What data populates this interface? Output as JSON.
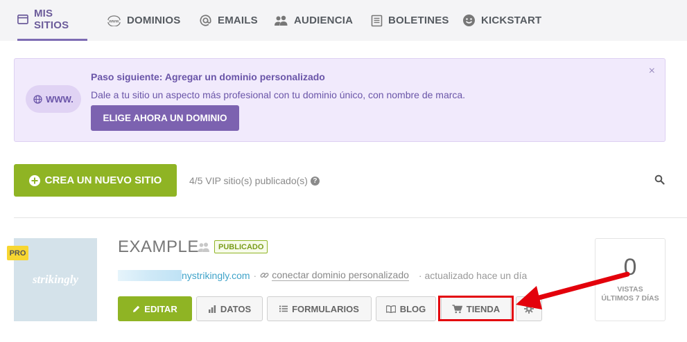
{
  "nav": {
    "items": [
      {
        "label": "MIS SITIOS",
        "icon": "browser-window-icon"
      },
      {
        "label": "DOMINIOS",
        "icon": "www-icon"
      },
      {
        "label": "EMAILS",
        "icon": "at-icon"
      },
      {
        "label": "AUDIENCIA",
        "icon": "users-icon"
      },
      {
        "label": "BOLETINES",
        "icon": "newsletter-icon"
      },
      {
        "label": "KICKSTART",
        "icon": "smiley-icon"
      }
    ],
    "www_icon_text": "www"
  },
  "banner": {
    "pill_label": "WWW.",
    "title": "Paso siguiente: Agregar un dominio personalizado",
    "text": "Dale a tu sitio un aspecto más profesional con tu dominio único, con nombre de marca.",
    "button": "ELIGE AHORA UN DOMINIO",
    "close": "×"
  },
  "toolbar": {
    "create_button": "CREA UN NUEVO SITIO",
    "vip_text": "4/5 VIP sitio(s) publicado(s)",
    "help": "?"
  },
  "site": {
    "pro_badge": "PRO",
    "thumb_logo": "strikingly",
    "name": "EXAMPLE",
    "status": "PUBLICADO",
    "url_suffix": "nystrikingly.com",
    "separator": "·",
    "connect_link": "conectar dominio personalizado",
    "updated": "· actualizado hace un día",
    "buttons": {
      "edit": "EDITAR",
      "data": "DATOS",
      "forms": "FORMULARIOS",
      "blog": "BLOG",
      "store": "TIENDA"
    },
    "stats": {
      "views": "0",
      "label_line1": "VISTAS",
      "label_line2": "ÚLTIMOS 7 DÍAS"
    }
  },
  "colors": {
    "accent_purple": "#7c62b0",
    "accent_green": "#8fb424",
    "highlight_red": "#e3000b"
  }
}
